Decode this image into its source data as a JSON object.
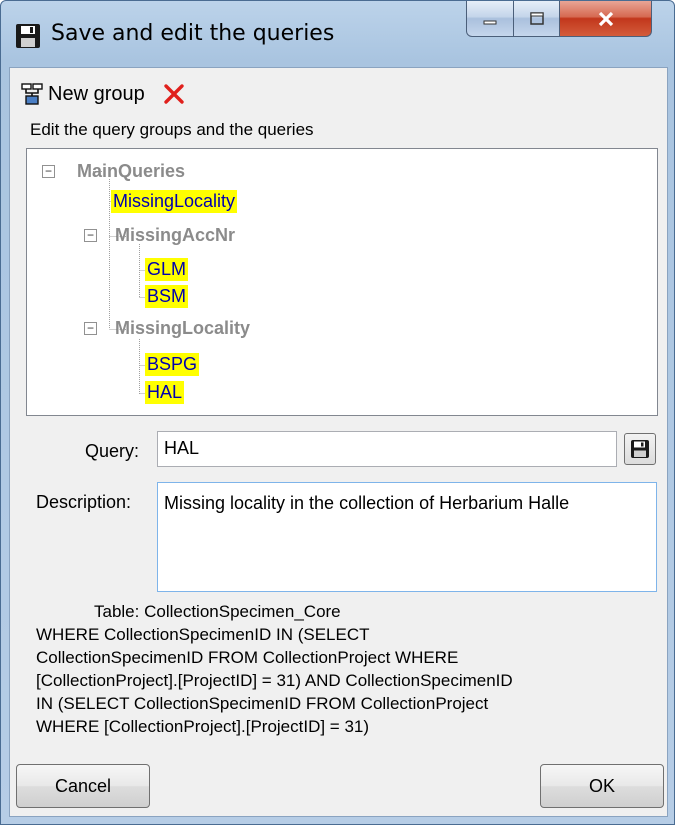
{
  "window": {
    "title": "Save and edit the queries"
  },
  "toolbar": {
    "new_group_label": "New group"
  },
  "hint": "Edit the query groups and the queries",
  "tree": {
    "root": "MainQueries",
    "root_leaf": "MissingLocality",
    "group1": "MissingAccNr",
    "group1_items": [
      "GLM",
      "BSM"
    ],
    "group2": "MissingLocality",
    "group2_items": [
      "BSPG",
      "HAL"
    ]
  },
  "query": {
    "label": "Query:",
    "value": "HAL"
  },
  "description": {
    "label": "Description:",
    "value": "Missing locality in the collection of Herbarium Halle"
  },
  "sql": {
    "table_line": "Table:   CollectionSpecimen_Core",
    "lines": [
      " WHERE CollectionSpecimenID IN (SELECT",
      "CollectionSpecimenID FROM CollectionProject WHERE",
      "[CollectionProject].[ProjectID] = 31) AND CollectionSpecimenID",
      "IN (SELECT CollectionSpecimenID FROM CollectionProject",
      "WHERE [CollectionProject].[ProjectID] = 31)"
    ]
  },
  "buttons": {
    "cancel": "Cancel",
    "ok": "OK"
  },
  "colors": {
    "highlight": "#ffff00",
    "leaf_text": "#0000b0",
    "group_text": "#8b8b8b",
    "delete": "#e0201c"
  }
}
